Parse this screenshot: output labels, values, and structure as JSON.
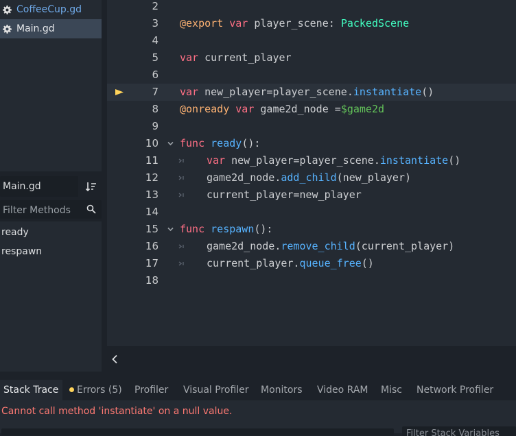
{
  "scripts": [
    {
      "name": "CoffeeCup.gd",
      "icon": "gear-icon",
      "selected": false
    },
    {
      "name": "Main.gd",
      "icon": "gear-icon",
      "selected": true
    }
  ],
  "methods_panel": {
    "current_file": "Main.gd",
    "filter_placeholder": "Filter Methods",
    "methods": [
      "ready",
      "respawn"
    ]
  },
  "editor": {
    "current_line": 7,
    "lines": [
      {
        "n": "2"
      },
      {
        "n": "3",
        "t": [
          "@export",
          " ",
          "var",
          " player_scene: ",
          "PackedScene"
        ]
      },
      {
        "n": "4"
      },
      {
        "n": "5",
        "t": [
          "var",
          " current_player"
        ]
      },
      {
        "n": "6"
      },
      {
        "n": "7",
        "t": [
          "var",
          " new_player=player_scene.",
          "instantiate",
          "()"
        ]
      },
      {
        "n": "8",
        "t": [
          "@onready",
          " ",
          "var",
          " game2d_node =",
          "$game2d"
        ]
      },
      {
        "n": "9"
      },
      {
        "n": "10",
        "t": [
          "func",
          " ",
          "ready",
          "():"
        ]
      },
      {
        "n": "11",
        "t": [
          "var",
          " new_player=player_scene.",
          "instantiate",
          "()"
        ]
      },
      {
        "n": "12",
        "t": [
          "game2d_node.",
          "add_child",
          "(new_player)"
        ]
      },
      {
        "n": "13",
        "t": [
          "current_player=new_player"
        ]
      },
      {
        "n": "14"
      },
      {
        "n": "15",
        "t": [
          "func",
          " ",
          "respawn",
          "():"
        ]
      },
      {
        "n": "16",
        "t": [
          "game2d_node.",
          "remove_child",
          "(current_player)"
        ]
      },
      {
        "n": "17",
        "t": [
          "current_player.",
          "queue_free",
          "()"
        ]
      },
      {
        "n": "18"
      }
    ]
  },
  "bottom_tabs": {
    "stack_trace": "Stack Trace",
    "errors": "Errors (5)",
    "profiler": "Profiler",
    "visual_profiler": "Visual Profiler",
    "monitors": "Monitors",
    "video_ram": "Video RAM",
    "misc": "Misc",
    "network_profiler": "Network Profiler"
  },
  "debugger": {
    "error_message": "Cannot call method 'instantiate' on a null value.",
    "vars_filter_placeholder": "Filter Stack Variables"
  },
  "colors": {
    "keyword": "#ff7085",
    "annotation": "#ffb373",
    "type": "#42ffc2",
    "function": "#57b3ff",
    "node_path": "#63c259",
    "error": "#ff7a73",
    "warning_dot": "#ffd35a"
  }
}
